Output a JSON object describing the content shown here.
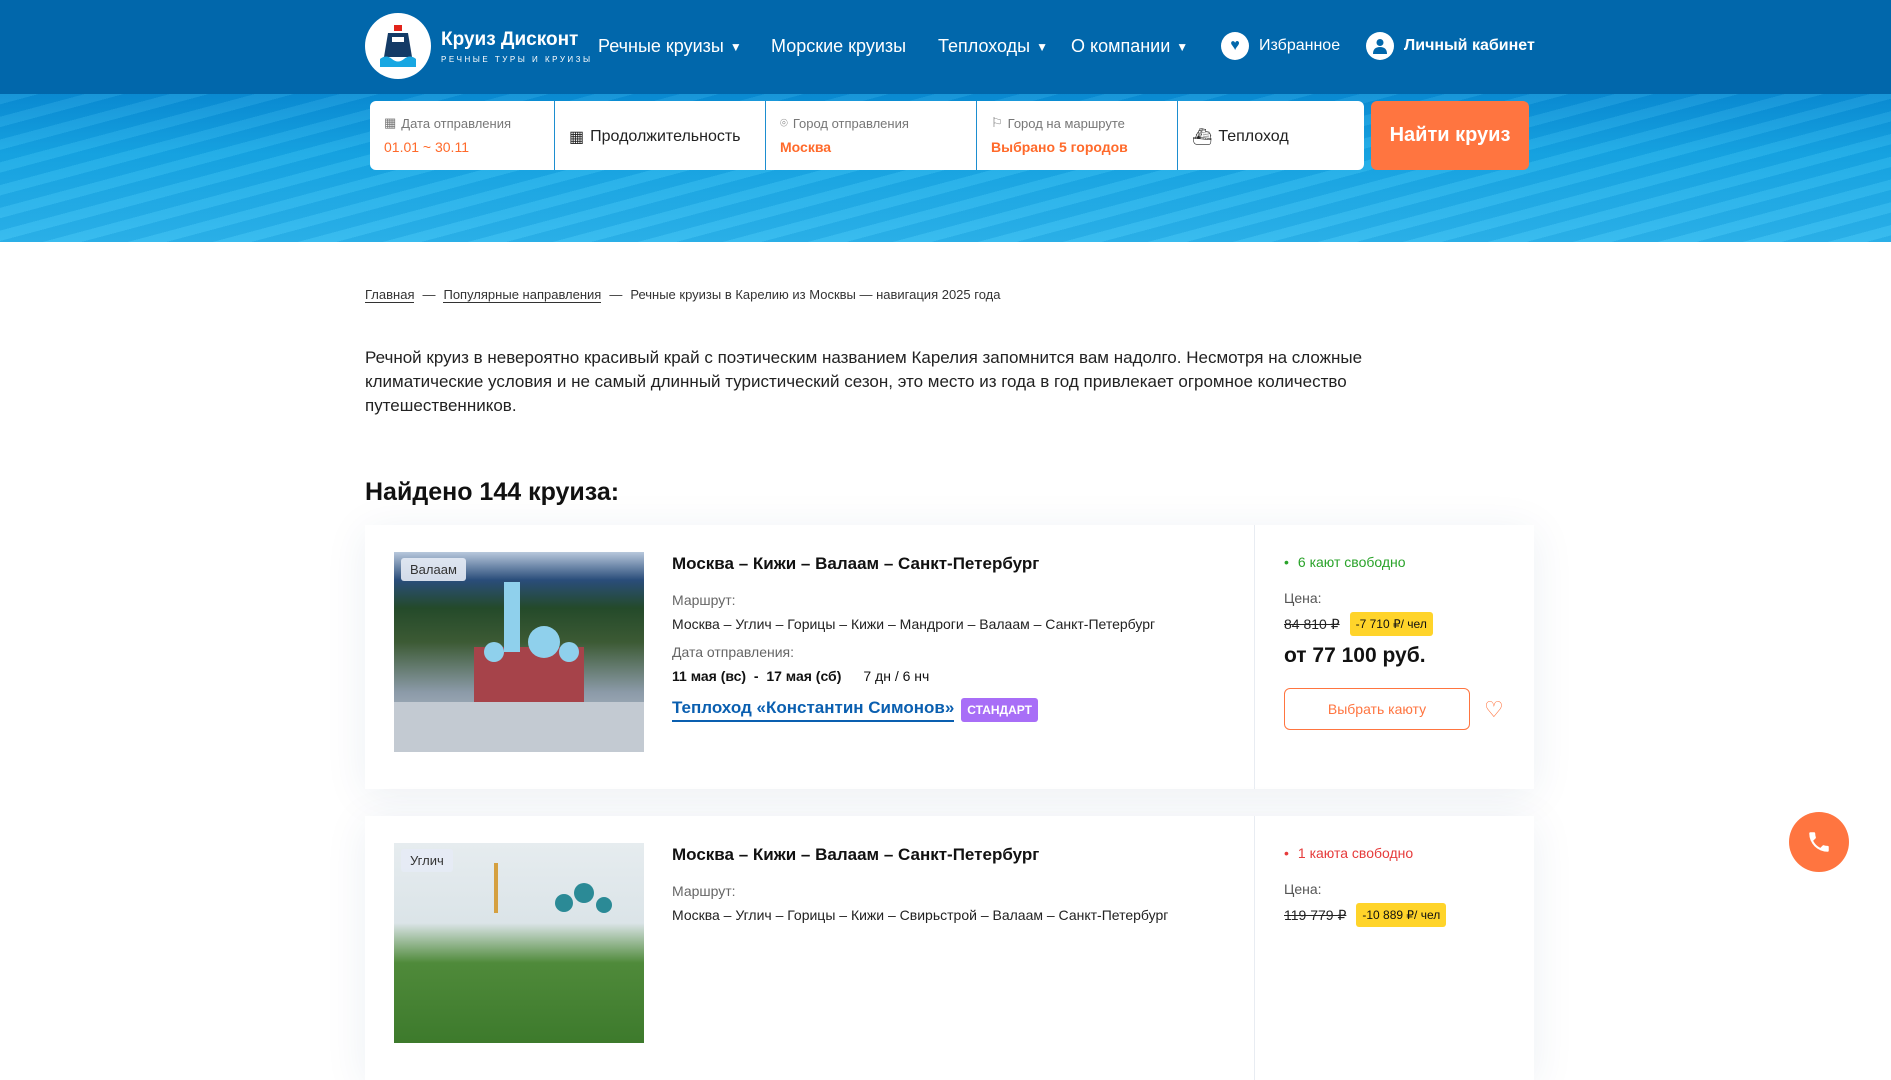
{
  "header": {
    "logo_title": "Круиз Дисконт",
    "logo_subtitle": "РЕЧНЫЕ ТУРЫ И КРУИЗЫ",
    "nav": [
      "Речные круизы",
      "Морские круизы",
      "Теплоходы",
      "О компании"
    ],
    "favorites": "Избранное",
    "account": "Личный кабинет"
  },
  "search": {
    "date_label": "Дата отправления",
    "date_value": "01.01 ~ 30.11",
    "duration": "Продолжительность",
    "city_label": "Город отправления",
    "city_value": "Москва",
    "route_label": "Город на маршруте",
    "route_value": "Выбрано 5 городов",
    "ship": "Теплоход",
    "button": "Найти круиз"
  },
  "breadcrumbs": [
    "Главная",
    "Популярные направления",
    "Речные круизы в Карелию из Москвы — навигация 2025 года"
  ],
  "breadcrumb_sep": "—",
  "intro": "Речной круиз в невероятно красивый край с поэтическим названием Карелия запомнится вам надолго. Несмотря на сложные климатические условия и не самый длинный туристический сезон, это место из года в год привлекает огромное количество путешественников.",
  "found": "Найдено 144 круиза:",
  "labels": {
    "route": "Маршрут:",
    "departure": "Дата отправления:",
    "price": "Цена:",
    "choose": "Выбрать каюту"
  },
  "cruises": [
    {
      "tag": "Валаам",
      "title": "Москва – Кижи – Валаам – Санкт-Петербург",
      "route": "Москва – Углич – Горицы – Кижи – Мандроги – Валаам – Санкт-Петербург",
      "date_from": "11 мая (вс)",
      "date_sep": "-",
      "date_to": "17 мая (сб)",
      "duration": "7 дн / 6 нч",
      "ship": "Теплоход «Константин Симонов»",
      "class": "СТАНДАРТ",
      "availability": "6 кают свободно",
      "old_price": "84 810 ₽",
      "discount": "-7 710 ₽/ чел",
      "price": "от 77 100 руб."
    },
    {
      "tag": "Углич",
      "title": "Москва – Кижи – Валаам – Санкт-Петербург",
      "route": "Москва – Углич – Горицы – Кижи – Свирьстрой – Валаам – Санкт-Петербург",
      "availability": "1 каюта свободно",
      "old_price": "119 779 ₽",
      "discount": "-10 889 ₽/ чел"
    }
  ]
}
